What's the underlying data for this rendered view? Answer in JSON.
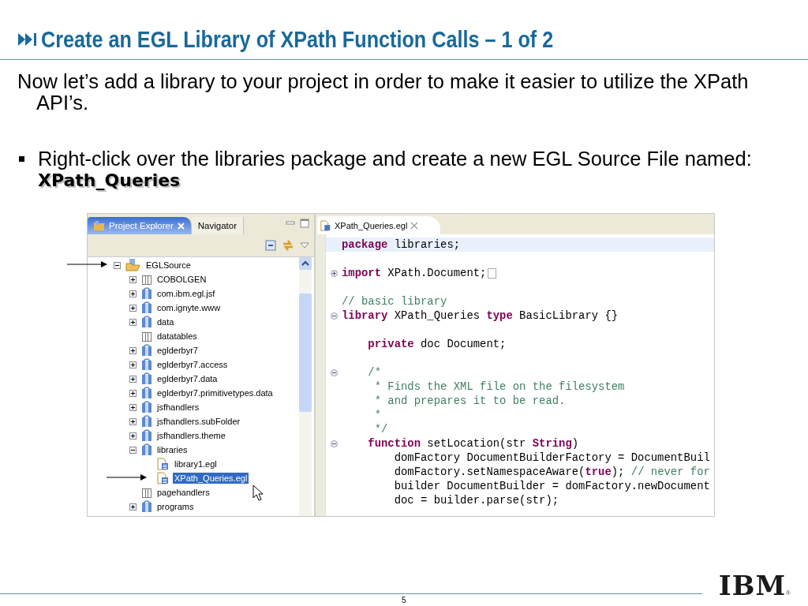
{
  "slide": {
    "title": "Create an EGL Library of XPath Function Calls – 1 of 2",
    "intro": "Now let’s add a library to your project in order to make it easier to utilize the XPath API’s.",
    "bullets": [
      {
        "text": "Right-click over the libraries package and create a new EGL Source File named:",
        "emphasis": "XPath_Queries"
      }
    ],
    "page_number": "5",
    "logo": {
      "text": "IBM",
      "mark": "®"
    }
  },
  "explorer": {
    "tabs": [
      {
        "label": "Project Explorer",
        "selected": true
      },
      {
        "label": "Navigator",
        "selected": false
      }
    ],
    "tree": [
      {
        "label": "EGLSource",
        "kind": "source-folder",
        "expandable": true,
        "expanded": true,
        "selected": false,
        "children": [
          {
            "label": "COBOLGEN",
            "kind": "empty-package",
            "expandable": true,
            "expanded": false,
            "selected": false
          },
          {
            "label": "com.ibm.egl.jsf",
            "kind": "package",
            "expandable": true,
            "expanded": false,
            "selected": false
          },
          {
            "label": "com.ignyte.www",
            "kind": "package",
            "expandable": true,
            "expanded": false,
            "selected": false
          },
          {
            "label": "data",
            "kind": "package",
            "expandable": true,
            "expanded": false,
            "selected": false
          },
          {
            "label": "datatables",
            "kind": "empty-package",
            "expandable": false,
            "selected": false
          },
          {
            "label": "eglderbyr7",
            "kind": "package",
            "expandable": true,
            "expanded": false,
            "selected": false
          },
          {
            "label": "eglderbyr7.access",
            "kind": "package",
            "expandable": true,
            "expanded": false,
            "selected": false
          },
          {
            "label": "eglderbyr7.data",
            "kind": "package",
            "expandable": true,
            "expanded": false,
            "selected": false
          },
          {
            "label": "eglderbyr7.primitivetypes.data",
            "kind": "package",
            "expandable": true,
            "expanded": false,
            "selected": false
          },
          {
            "label": "jsfhandlers",
            "kind": "package",
            "expandable": true,
            "expanded": false,
            "selected": false
          },
          {
            "label": "jsfhandlers.subFolder",
            "kind": "package",
            "expandable": true,
            "expanded": false,
            "selected": false
          },
          {
            "label": "jsfhandlers.theme",
            "kind": "package",
            "expandable": true,
            "expanded": false,
            "selected": false
          },
          {
            "label": "libraries",
            "kind": "package",
            "expandable": true,
            "expanded": true,
            "selected": false,
            "children": [
              {
                "label": "library1.egl",
                "kind": "file",
                "expandable": false,
                "selected": false
              },
              {
                "label": "XPath_Queries.egl",
                "kind": "file",
                "expandable": false,
                "selected": true
              }
            ]
          },
          {
            "label": "pagehandlers",
            "kind": "empty-package",
            "expandable": false,
            "selected": false
          },
          {
            "label": "programs",
            "kind": "package",
            "expandable": true,
            "expanded": false,
            "selected": false
          }
        ]
      }
    ]
  },
  "editor": {
    "tab": {
      "label": "XPath_Queries.egl",
      "selected": true
    },
    "lines": [
      {
        "current": true,
        "segments": [
          {
            "kind": "keyword",
            "text": "package"
          },
          {
            "kind": "plain",
            "text": " libraries;"
          }
        ]
      },
      {
        "current": false
      },
      {
        "current": false,
        "foldable": true,
        "folded": true,
        "segments": [
          {
            "kind": "keyword",
            "text": "import"
          },
          {
            "kind": "plain",
            "text": " XPath.Document;"
          }
        ]
      },
      {
        "current": false
      },
      {
        "current": false,
        "segments": [
          {
            "kind": "comment",
            "text": "// basic library"
          }
        ]
      },
      {
        "current": false,
        "foldable": true,
        "folded": false,
        "segments": [
          {
            "kind": "keyword",
            "text": "library"
          },
          {
            "kind": "plain",
            "text": " XPath_Queries "
          },
          {
            "kind": "keyword",
            "text": "type"
          },
          {
            "kind": "plain",
            "text": " BasicLibrary {}"
          }
        ]
      },
      {
        "current": false
      },
      {
        "current": false,
        "segments": [
          {
            "kind": "keyword",
            "text": "    private"
          },
          {
            "kind": "plain",
            "text": " doc Document;"
          }
        ]
      },
      {
        "current": false
      },
      {
        "current": false,
        "foldable": true,
        "folded": false,
        "segments": [
          {
            "kind": "comment",
            "text": "    /*"
          }
        ]
      },
      {
        "current": false,
        "segments": [
          {
            "kind": "comment",
            "text": "     * Finds the XML file on the filesystem"
          }
        ]
      },
      {
        "current": false,
        "segments": [
          {
            "kind": "comment",
            "text": "     * and prepares it to be read."
          }
        ]
      },
      {
        "current": false,
        "segments": [
          {
            "kind": "comment",
            "text": "     *"
          }
        ]
      },
      {
        "current": false,
        "segments": [
          {
            "kind": "comment",
            "text": "     */"
          }
        ]
      },
      {
        "current": false,
        "foldable": true,
        "folded": false,
        "segments": [
          {
            "kind": "keyword",
            "text": "    function"
          },
          {
            "kind": "plain",
            "text": " setLocation(str "
          },
          {
            "kind": "keyword",
            "text": "String"
          },
          {
            "kind": "plain",
            "text": ")"
          }
        ]
      },
      {
        "current": false,
        "segments": [
          {
            "kind": "plain",
            "text": "        domFactory DocumentBuilderFactory = DocumentBuil"
          }
        ]
      },
      {
        "current": false,
        "segments": [
          {
            "kind": "plain",
            "text": "        domFactory.setNamespaceAware("
          },
          {
            "kind": "keyword",
            "text": "true"
          },
          {
            "kind": "plain",
            "text": "); "
          },
          {
            "kind": "comment",
            "text": "// never for"
          }
        ]
      },
      {
        "current": false,
        "segments": [
          {
            "kind": "plain",
            "text": "        builder DocumentBuilder = domFactory.newDocument"
          }
        ]
      },
      {
        "current": false,
        "segments": [
          {
            "kind": "plain",
            "text": "        doc = builder.parse(str);"
          }
        ]
      }
    ]
  }
}
